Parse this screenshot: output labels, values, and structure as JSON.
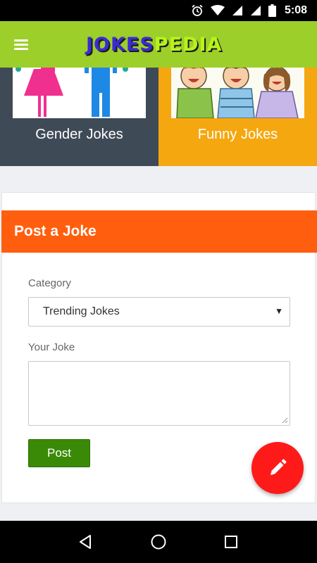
{
  "status_bar": {
    "time": "5:08",
    "icons": [
      "alarm-icon",
      "wifi-icon",
      "signal-r-icon",
      "signal-r-icon",
      "battery-icon"
    ]
  },
  "app_bar": {
    "menu_icon": "hamburger-menu-icon",
    "logo_part1": "JOKES",
    "logo_part2": "PEDIA"
  },
  "categories": [
    {
      "label": "Gender Jokes",
      "art": "gender-figures-illustration",
      "color": "#3f4a57"
    },
    {
      "label": "Funny Jokes",
      "art": "laughing-kids-illustration",
      "color": "#f5a70f"
    }
  ],
  "post_form": {
    "header": "Post a Joke",
    "category_label": "Category",
    "category_value": "Trending Jokes",
    "joke_label": "Your Joke",
    "joke_value": "",
    "submit_label": "Post"
  },
  "fab": {
    "icon": "pencil-icon",
    "color": "#ff1a1a"
  },
  "nav_bar": {
    "icons": [
      "back-triangle-icon",
      "home-circle-icon",
      "recents-square-icon"
    ]
  },
  "colors": {
    "app_bar": "#9ccf2a",
    "form_header": "#ff5e0e",
    "post_button": "#3a8a07"
  }
}
